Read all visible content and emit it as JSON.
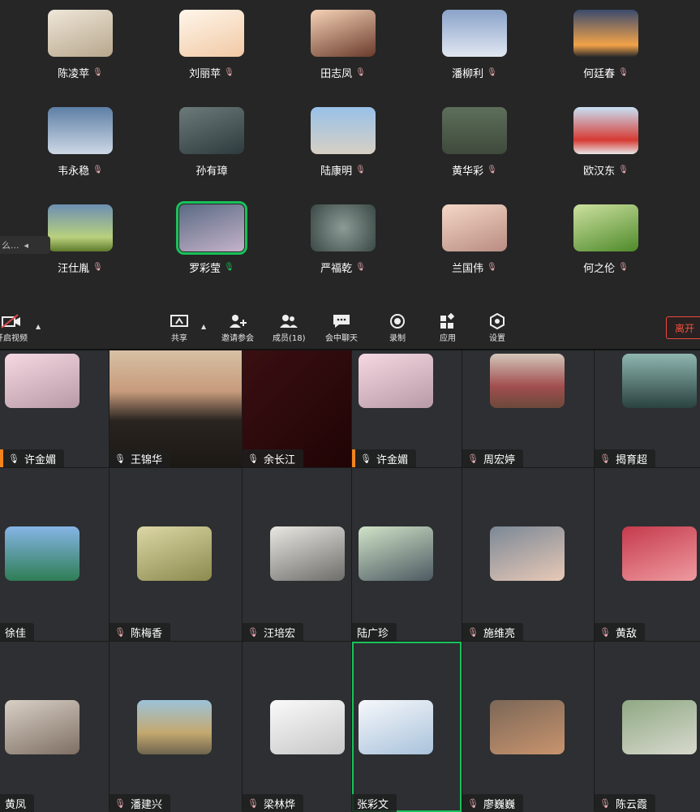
{
  "top_participants": [
    {
      "name": "陈凌苹",
      "mic": "muted"
    },
    {
      "name": "刘丽苹",
      "mic": "muted"
    },
    {
      "name": "田志凤",
      "mic": "muted"
    },
    {
      "name": "潘柳利",
      "mic": "muted"
    },
    {
      "name": "何廷春",
      "mic": "muted"
    },
    {
      "name": "韦永稳",
      "mic": "muted"
    },
    {
      "name": "孙有璋",
      "mic": "muted"
    },
    {
      "name": "陆康明",
      "mic": "muted"
    },
    {
      "name": "黄华彩",
      "mic": "muted"
    },
    {
      "name": "欧汉东",
      "mic": "muted"
    },
    {
      "name": "汪仕胤",
      "mic": "muted"
    },
    {
      "name": "罗彩莹",
      "mic": "on"
    },
    {
      "name": "严福乾",
      "mic": "muted"
    },
    {
      "name": "兰国伟",
      "mic": "muted"
    },
    {
      "name": "何之伦",
      "mic": "muted"
    }
  ],
  "side_tab": {
    "label": "么..."
  },
  "toolbar": {
    "video": "开启视频",
    "share": "共享",
    "invite": "邀请参会",
    "members": "成员(18)",
    "chat": "会中聊天",
    "record": "录制",
    "apps": "应用",
    "settings": "设置",
    "leave": "离开"
  },
  "video_tiles": [
    {
      "name": "许金媚"
    },
    {
      "name": "王锦华"
    },
    {
      "name": "余长江"
    },
    {
      "name": "许金媚"
    },
    {
      "name": "周宏婷"
    },
    {
      "name": "揭育超"
    },
    {
      "name": "徐佳"
    },
    {
      "name": "陈梅香"
    },
    {
      "name": "汪培宏"
    },
    {
      "name": "陆广珍"
    },
    {
      "name": "施维亮"
    },
    {
      "name": "黄敌"
    },
    {
      "name": "黄凤"
    },
    {
      "name": "潘建兴"
    },
    {
      "name": "梁林烨"
    },
    {
      "name": "张彩文"
    },
    {
      "name": "廖巍巍"
    },
    {
      "name": "陈云霞"
    }
  ],
  "colors": {
    "speaking": "#19c25b",
    "leave": "#f0513d",
    "accent": "#f2841b",
    "background": "#262626"
  }
}
